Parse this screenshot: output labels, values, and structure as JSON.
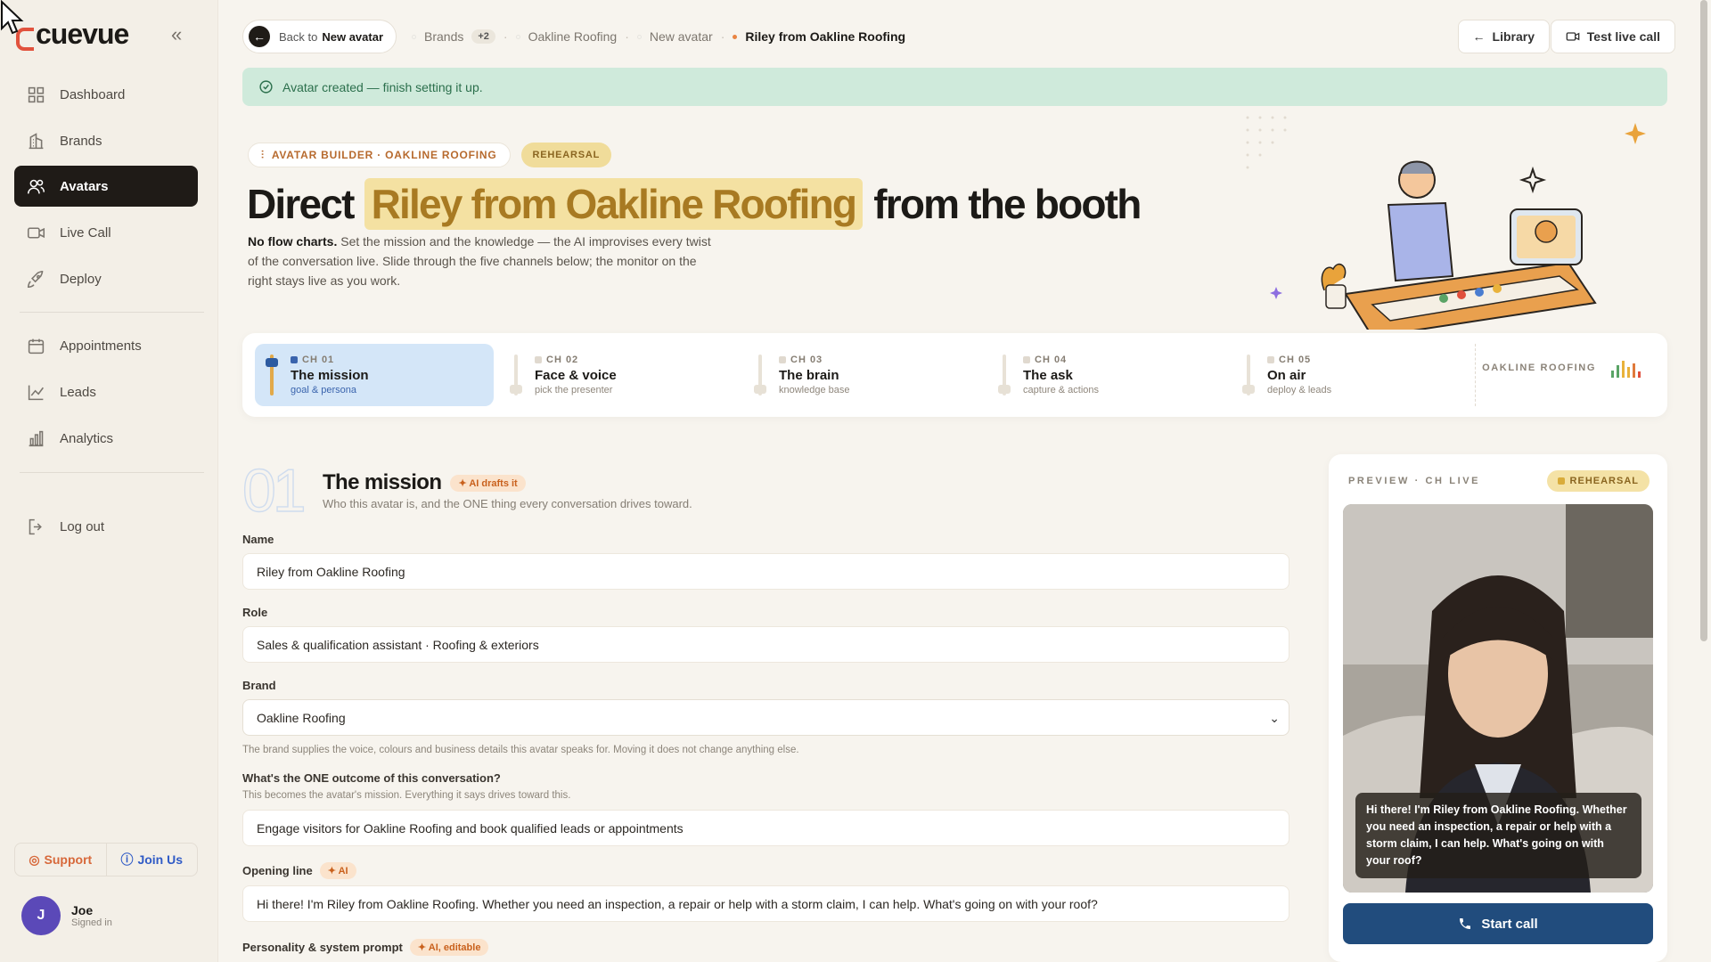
{
  "sidebar": {
    "logo": "cuevue",
    "items": [
      {
        "label": "Dashboard",
        "icon": "dashboard-icon"
      },
      {
        "label": "Brands",
        "icon": "building-icon"
      },
      {
        "label": "Avatars",
        "icon": "users-icon",
        "active": true
      },
      {
        "label": "Live Call",
        "icon": "video-icon"
      },
      {
        "label": "Deploy",
        "icon": "rocket-icon"
      },
      {
        "label": "Appointments",
        "icon": "calendar-icon"
      },
      {
        "label": "Leads",
        "icon": "trend-icon"
      },
      {
        "label": "Analytics",
        "icon": "bar-chart-icon"
      },
      {
        "label": "Log out",
        "icon": "logout-icon"
      }
    ],
    "support": "Support",
    "join": "Join Us",
    "user": {
      "initial": "J",
      "name": "Joe",
      "status": "Signed in"
    }
  },
  "topbar": {
    "back_prefix": "Back to",
    "back_target": "New avatar",
    "crumbs": [
      "Brands",
      "Oakline Roofing",
      "New avatar",
      "Riley from Oakline Roofing"
    ],
    "crumb_count": "+2",
    "library": "Library",
    "test_call": "Test live call"
  },
  "banner": "Avatar created — finish setting it up.",
  "tags": {
    "builder": "AVATAR BUILDER · OAKLINE ROOFING",
    "mode": "REHEARSAL"
  },
  "hero": {
    "pre": "Direct",
    "highlight": "Riley from Oakline Roofing",
    "post": "from the booth",
    "sub_bold": "No flow charts.",
    "sub": "Set the mission and the knowledge — the AI improvises every twist of the conversation live. Slide through the five channels below; the monitor on the right stays live as you work."
  },
  "channels": [
    {
      "key": "CH 01",
      "title": "The mission",
      "sub": "goal & persona"
    },
    {
      "key": "CH 02",
      "title": "Face & voice",
      "sub": "pick the presenter"
    },
    {
      "key": "CH 03",
      "title": "The brain",
      "sub": "knowledge base"
    },
    {
      "key": "CH 04",
      "title": "The ask",
      "sub": "capture & actions"
    },
    {
      "key": "CH 05",
      "title": "On air",
      "sub": "deploy & leads"
    }
  ],
  "channel_brand": "OAKLINE ROOFING",
  "section": {
    "num": "01",
    "title": "The mission",
    "badge": "AI drafts it",
    "sub": "Who this avatar is, and the ONE thing every conversation drives toward."
  },
  "form": {
    "name_label": "Name",
    "name_value": "Riley from Oakline Roofing",
    "role_label": "Role",
    "role_value": "Sales & qualification assistant · Roofing & exteriors",
    "brand_label": "Brand",
    "brand_value": "Oakline Roofing",
    "brand_help": "The brand supplies the voice, colours and business details this avatar speaks for. Moving it does not change anything else.",
    "outcome_label": "What's the ONE outcome of this conversation?",
    "outcome_help": "This becomes the avatar's mission. Everything it says drives toward this.",
    "outcome_value": "Engage visitors for Oakline Roofing and book qualified leads or appointments",
    "opening_label": "Opening line",
    "opening_badge": "AI",
    "opening_value": "Hi there! I'm Riley from Oakline Roofing. Whether you need an inspection, a repair or help with a storm claim, I can help. What's going on with your roof?",
    "prompt_label": "Personality & system prompt",
    "prompt_badge": "AI, editable"
  },
  "preview": {
    "label": "PREVIEW · CH LIVE",
    "badge": "REHEARSAL",
    "caption": "Hi there! I'm Riley from Oakline Roofing. Whether you need an inspection, a repair or help with a storm claim, I can help. What's going on with your roof?",
    "button": "Start call"
  },
  "colors": {
    "accent": "#e1523d",
    "highlight": "#f4e1a2",
    "call_button": "#214c7d",
    "banner": "#cfeadb"
  }
}
